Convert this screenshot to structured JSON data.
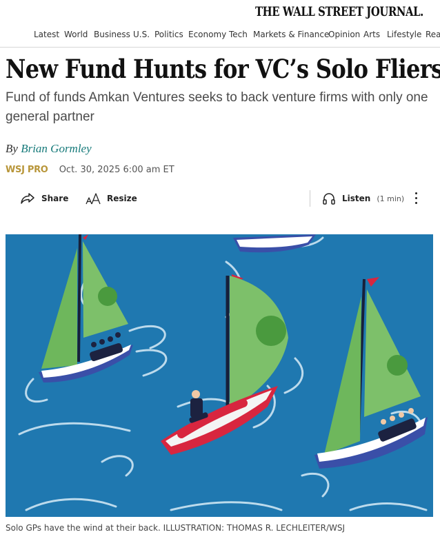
{
  "masthead": {
    "logo": "THE WALL STREET JOURNAL."
  },
  "nav": {
    "items": [
      "Latest",
      "World",
      "Business",
      "U.S.",
      "Politics",
      "Economy",
      "Tech",
      "Markets & Finance",
      "Opinion",
      "Arts",
      "Lifestyle",
      "Rea"
    ]
  },
  "article": {
    "headline": "New Fund Hunts for VC’s Solo Fliers",
    "dek": "Fund of funds Amkan Ventures seeks to back venture firms with only one general partner",
    "byline_prefix": "By",
    "author": "Brian Gormley",
    "kicker": "WSJ PRO",
    "date": "Oct. 30, 2025 6:00 am ET"
  },
  "toolbar": {
    "share_label": "Share",
    "resize_label": "Resize",
    "listen_label": "Listen",
    "listen_duration": "(1 min)"
  },
  "image": {
    "caption": "Solo GPs have the wind at their back. ILLUSTRATION: THOMAS R. LECHLEITER/WSJ"
  },
  "colors": {
    "author_link": "#167a7a",
    "kicker": "#b8963a",
    "sea": "#1f78b0",
    "sail_green": "#7dc06a",
    "hull_red": "#d8263f",
    "hull_navy": "#283a8c"
  },
  "icons": {
    "share": "share-arrow-icon",
    "resize": "text-resize-icon",
    "listen": "headphones-icon",
    "more": "vertical-ellipsis-icon"
  }
}
